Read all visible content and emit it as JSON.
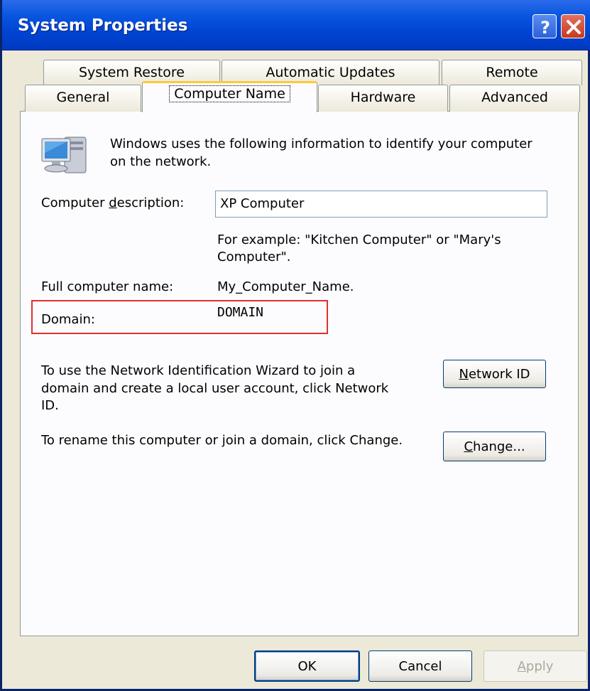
{
  "window": {
    "title": "System Properties"
  },
  "tabs": {
    "row_back": [
      "System Restore",
      "Automatic Updates",
      "Remote"
    ],
    "row_front": [
      "General",
      "Computer Name",
      "Hardware",
      "Advanced"
    ],
    "active": "Computer Name"
  },
  "panel": {
    "intro_line1": "Windows uses the following information to identify your computer",
    "intro_line2": "on the network.",
    "description_label_pre": "Computer ",
    "description_label_key": "d",
    "description_label_post": "escription:",
    "description_value": "XP Computer",
    "example_line1": "For example: \"Kitchen Computer\" or \"Mary's",
    "example_line2": "Computer\".",
    "full_name_label": "Full computer name:",
    "full_name_value": "My_Computer_Name.",
    "domain_label": "Domain:",
    "domain_value": "DOMAIN",
    "netid_text_line1": "To use the Network Identification Wizard to join a",
    "netid_text_line2": "domain and create a local user account, click Network",
    "netid_text_line3": "ID.",
    "netid_button_key": "N",
    "netid_button_rest": "etwork ID",
    "change_text": "To rename this computer or join a domain, click Change.",
    "change_button_key": "C",
    "change_button_rest": "hange..."
  },
  "footer": {
    "ok_label": "OK",
    "cancel_label": "Cancel",
    "apply_key": "A",
    "apply_rest": "pply"
  },
  "icons": {
    "computer": "computer-monitor-icon",
    "help": "help-icon",
    "close": "close-icon"
  }
}
